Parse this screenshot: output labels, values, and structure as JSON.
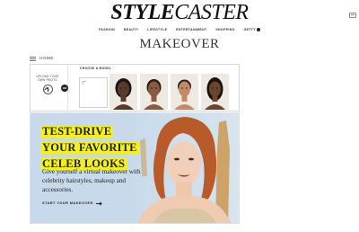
{
  "header": {
    "logo_part1": "STYLE",
    "logo_part2": "CASTER",
    "right_icon": "mail-icon"
  },
  "nav": {
    "items": [
      "FASHION",
      "BEAUTY",
      "LIFESTYLE",
      "ENTERTAINMENT",
      "SHOPPING",
      "GETTY"
    ],
    "more_icon": "dots-icon"
  },
  "page": {
    "title": "MAKEOVER"
  },
  "home_bar": {
    "label": "HOME",
    "menu_icon": "hamburger-icon"
  },
  "upload": {
    "label": "UPLOAD YOUR OWN PHOTO",
    "icon": "upload-arrow-icon",
    "or_label": "OR"
  },
  "models": {
    "label": "CHOOSE A MODEL",
    "items": [
      {
        "name": "model-1",
        "skin": "#5a3a2a",
        "hair": "#1c1410"
      },
      {
        "name": "model-2",
        "skin": "#8a5a3e",
        "hair": "#2a1a12"
      },
      {
        "name": "model-3",
        "skin": "#c48a66",
        "hair": "#2a1f18"
      },
      {
        "name": "model-4",
        "skin": "#6a452f",
        "hair": "#1a120c"
      }
    ]
  },
  "hero": {
    "headline": [
      "TEST-DRIVE",
      "YOUR FAVORITE",
      "CELEB LOOKS"
    ],
    "description": "Give yourself a virtual makeover with celebrity hairstyles, makeup and accessories.",
    "cta": "START YOUR MAKEOVER",
    "accent": "#f4ef1e",
    "background": "#c7d9ea"
  }
}
